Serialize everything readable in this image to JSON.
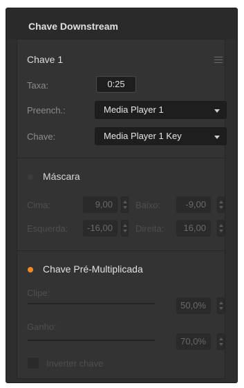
{
  "panel": {
    "title": "Chave Downstream"
  },
  "key": {
    "title": "Chave 1",
    "menu_icon": "hamburger-menu-icon",
    "rate_label": "Taxa:",
    "rate_value": "0:25",
    "fill_label": "Preench.:",
    "fill_value": "Media Player 1",
    "key_label": "Chave:",
    "key_value": "Media Player 1 Key"
  },
  "mask": {
    "label": "Máscara",
    "enabled": false,
    "top_label": "Cima:",
    "top_value": "9,00",
    "bottom_label": "Baixo:",
    "bottom_value": "-9,00",
    "left_label": "Esquerda:",
    "left_value": "-16,00",
    "right_label": "Direita:",
    "right_value": "16,00"
  },
  "premultiplied": {
    "label": "Chave Pré-Multiplicada",
    "enabled": true,
    "clip_label": "Clipe:",
    "clip_value": "50,0%",
    "gain_label": "Ganho:",
    "gain_value": "70,0%",
    "invert_label": "Inverter chave",
    "invert_checked": false
  },
  "colors": {
    "panel_bg": "#2e2e2e",
    "active_dot": "#f08a24",
    "inactive_dot": "#3c3c3c"
  }
}
